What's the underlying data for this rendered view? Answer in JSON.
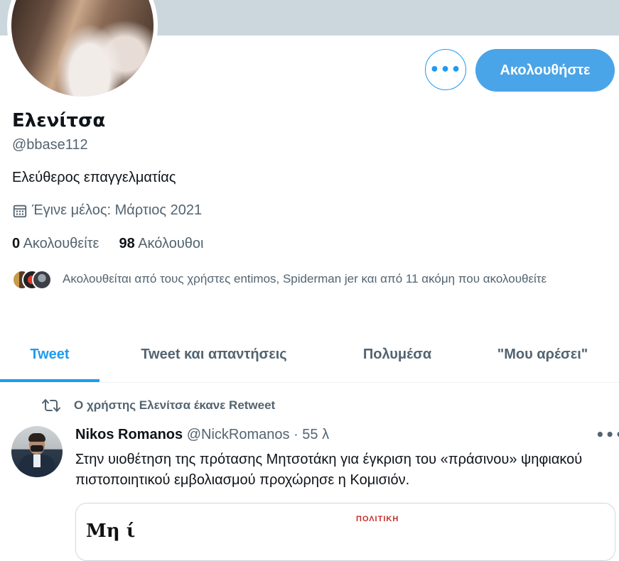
{
  "profile": {
    "name": "Ελενίτσα",
    "handle": "@bbase112",
    "bio": "Ελεύθερος επαγγελματίας",
    "joined": "Έγινε μέλος: Μάρτιος 2021",
    "following_count": "0",
    "following_label": "Ακολουθείτε",
    "followers_count": "98",
    "followers_label": "Ακόλουθοι",
    "followed_by": "Ακολουθείται από τους χρήστες entimos, Spiderman jer και από 11 ακόμη που ακολουθείτε"
  },
  "actions": {
    "more_label": "•••",
    "follow_label": "Ακολουθήστε"
  },
  "tabs": [
    {
      "label": "Tweet",
      "active": true
    },
    {
      "label": "Tweet και απαντήσεις",
      "active": false
    },
    {
      "label": "Πολυμέσα",
      "active": false
    },
    {
      "label": "\"Μου αρέσει\"",
      "active": false
    }
  ],
  "tweet": {
    "retweet_note": "Ο χρήστης Ελενίτσα έκανε Retweet",
    "author_name": "Nikos Romanos",
    "author_handle": "@NickRomanos",
    "time": "· 55 λ",
    "more_label": "•••",
    "text": "Στην υιοθέτηση της πρότασης Μητσοτάκη για έγκριση του «πράσινου» ψηφιακού πιστοποιητικού εμβολιασμού προχώρησε η Κομισιόν.",
    "card_section": "ΠΟΛΙΤΙΚΗ",
    "card_image_text": "Μη ί"
  },
  "colors": {
    "accent": "#1d9bf0",
    "follow_button": "#4aa4e8",
    "banner": "#ccd6dd",
    "secondary_text": "#536471"
  },
  "icons": {
    "calendar": "calendar-icon",
    "retweet": "retweet-icon",
    "more": "more-horizontal-icon"
  }
}
